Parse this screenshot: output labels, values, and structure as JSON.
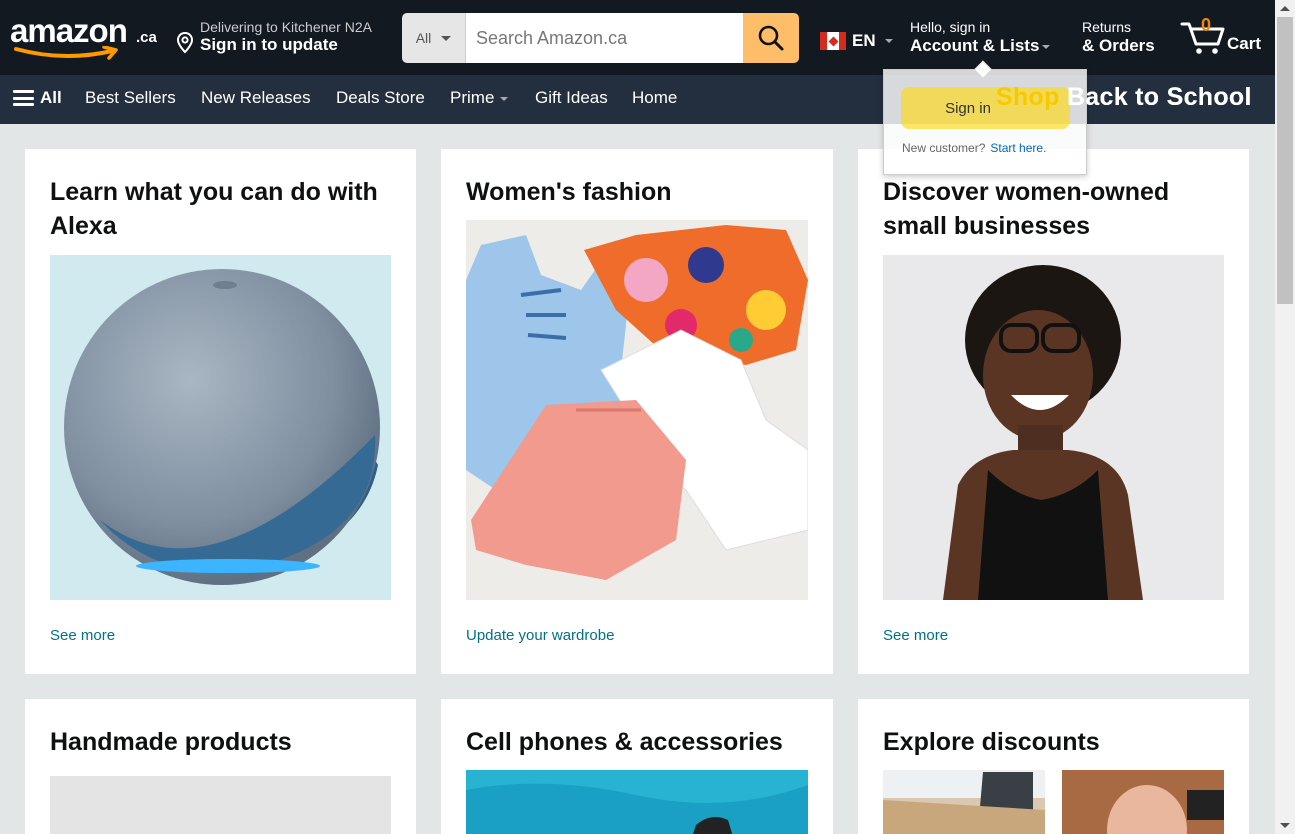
{
  "header": {
    "logo_text": "amazon",
    "logo_suffix": ".ca",
    "deliver_line1": "Delivering to Kitchener N2A",
    "deliver_line2": "Sign in to update",
    "search_category": "All",
    "search_placeholder": "Search Amazon.ca",
    "language": "EN",
    "account_line1": "Hello, sign in",
    "account_line2": "Account & Lists",
    "returns_line1": "Returns",
    "returns_line2": "& Orders",
    "cart_count": "0",
    "cart_label": "Cart"
  },
  "subnav": {
    "all_label": "All",
    "links": [
      "Best Sellers",
      "New Releases",
      "Deals Store",
      "Prime",
      "Gift Ideas",
      "Home"
    ],
    "promo_part1": "Shop",
    "promo_part2": "Back to School"
  },
  "flyout": {
    "signin_label": "Sign in",
    "new_customer": "New customer?",
    "start_here": "Start here."
  },
  "cards": [
    {
      "title": "Learn what you can do with Alexa",
      "link": "See more",
      "image": "echo-speaker-image"
    },
    {
      "title": "Women's fashion",
      "link": "Update your wardrobe",
      "image": "fashion-clothes-image"
    },
    {
      "title": "Discover women-owned small businesses",
      "link": "See more",
      "image": "woman-portrait-image"
    },
    {
      "title": "Handmade products",
      "link": "",
      "image": "handmade-image"
    },
    {
      "title": "Cell phones & accessories",
      "link": "",
      "image": "phones-image"
    },
    {
      "title": "Explore discounts",
      "link": "",
      "image": "discounts-image"
    }
  ],
  "colors": {
    "nav_top": "#131921",
    "nav_sub": "#232f3e",
    "search_button": "#febd69",
    "cart_count": "#f08804",
    "link": "#007185",
    "page_bg": "#e3e6e6"
  }
}
